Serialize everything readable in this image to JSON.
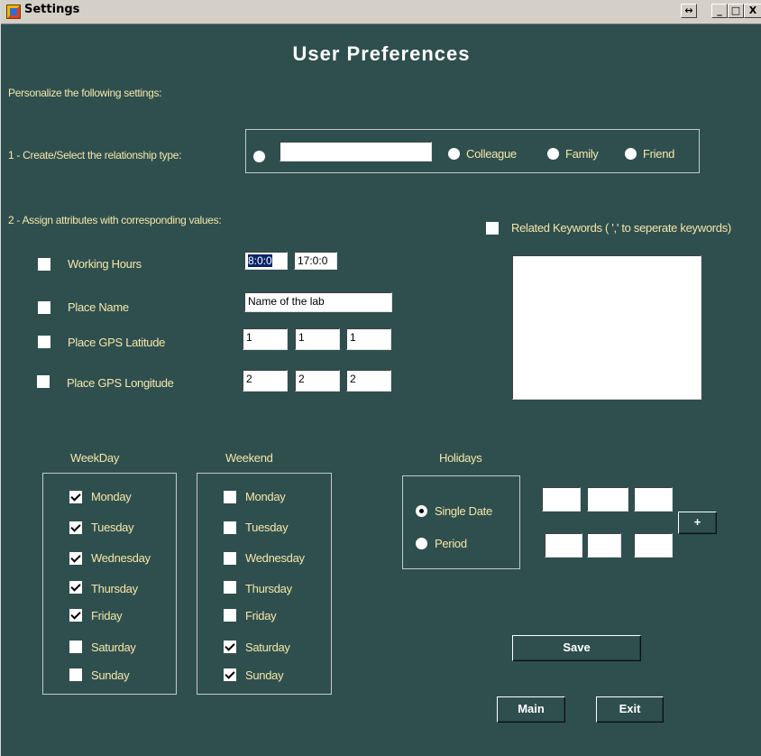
{
  "window": {
    "title": "Settings",
    "controls": [
      "↔",
      "_",
      "□",
      "X"
    ]
  },
  "heading": "User Preferences",
  "intro": "Personalize the following settings:",
  "step1": {
    "label": "1 - Create/Select the relationship type:",
    "custom_value": "",
    "options": [
      "Colleague",
      "Family",
      "Friend"
    ]
  },
  "step2": {
    "label": "2 - Assign attributes with corresponding values:",
    "working_hours": {
      "label": "Working Hours",
      "start": "8:0:0",
      "end": "17:0:0"
    },
    "place_name": {
      "label": "Place Name",
      "value": "Name of the lab"
    },
    "latitude": {
      "label": "Place GPS Latitude",
      "values": [
        "1",
        "1",
        "1"
      ]
    },
    "longitude": {
      "label": "Place GPS Longitude",
      "values": [
        "2",
        "2",
        "2"
      ]
    },
    "keywords": {
      "label": "Related Keywords ( ',' to seperate keywords)"
    }
  },
  "weekday": {
    "title": "WeekDay",
    "days": [
      {
        "label": "Monday",
        "checked": true
      },
      {
        "label": "Tuesday",
        "checked": true
      },
      {
        "label": "Wednesday",
        "checked": true
      },
      {
        "label": "Thursday",
        "checked": true
      },
      {
        "label": "Friday",
        "checked": true
      },
      {
        "label": "Saturday",
        "checked": false
      },
      {
        "label": "Sunday",
        "checked": false
      }
    ]
  },
  "weekend": {
    "title": "Weekend",
    "days": [
      {
        "label": "Monday",
        "checked": false
      },
      {
        "label": "Tuesday",
        "checked": false
      },
      {
        "label": "Wednesday",
        "checked": false
      },
      {
        "label": "Thursday",
        "checked": false
      },
      {
        "label": "Friday",
        "checked": false
      },
      {
        "label": "Saturday",
        "checked": true
      },
      {
        "label": "Sunday",
        "checked": true
      }
    ]
  },
  "holidays": {
    "title": "Holidays",
    "single_date": "Single Date",
    "period": "Period",
    "selected": "Single Date",
    "add_label": "+"
  },
  "buttons": {
    "save": "Save",
    "main": "Main",
    "exit": "Exit"
  }
}
